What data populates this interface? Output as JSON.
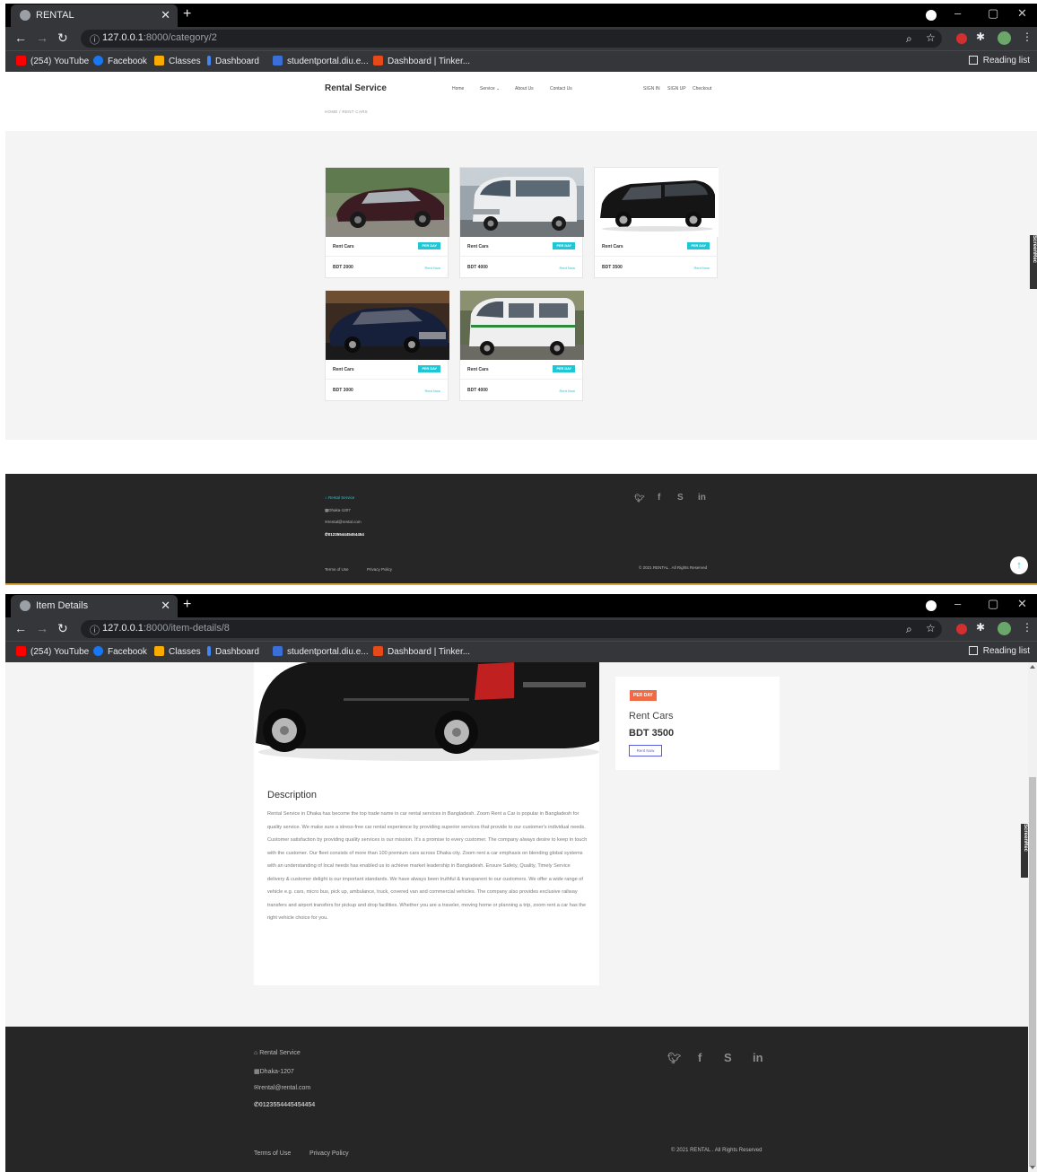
{
  "browser": {
    "bookmarks": [
      {
        "label": "(254) YouTube",
        "color": "#ff0000"
      },
      {
        "label": "Facebook",
        "color": "#1877f2"
      },
      {
        "label": "Classes",
        "color": "#f9ab00"
      },
      {
        "label": "Dashboard",
        "color": "#4285f4"
      },
      {
        "label": "studentportal.diu.e...",
        "color": "#3b6fd8"
      },
      {
        "label": "Dashboard | Tinker...",
        "color": "#e64a19"
      }
    ],
    "reading_list": "Reading list"
  },
  "window1": {
    "tab_title": "RENTAL",
    "url_host": "127.0.0.1",
    "url_rest": ":8000/category/2"
  },
  "window2": {
    "tab_title": "Item Details",
    "url_host": "127.0.0.1",
    "url_rest": ":8000/item-details/8"
  },
  "site": {
    "brand": "Rental Service",
    "nav": [
      "Home",
      "Service ⌄",
      "About Us",
      "Contact Us"
    ],
    "auth": [
      "SIGN IN",
      "SIGN UP",
      "Checkout"
    ],
    "breadcrumb": "HOME  /  RENT CARS"
  },
  "listing": {
    "cards": [
      {
        "name": "Rent Cars",
        "badge": "PER DAY",
        "price": "BDT 2000",
        "action": "Rent Now"
      },
      {
        "name": "Rent Cars",
        "badge": "PER DAY",
        "price": "BDT 4000",
        "action": "Rent Now"
      },
      {
        "name": "Rent Cars",
        "badge": "PER DAY",
        "price": "BDT 3500",
        "action": "Rent Now"
      },
      {
        "name": "Rent Cars",
        "badge": "PER DAY",
        "price": "BDT 3000",
        "action": "Rent Now"
      },
      {
        "name": "Rent Cars",
        "badge": "PER DAY",
        "price": "BDT 4000",
        "action": "Rent Now"
      }
    ]
  },
  "footer": {
    "brand": "Rental Service",
    "address": "Dhaka-1207",
    "email": "rental@rental.com",
    "phone": "0123554445454454",
    "links": [
      "Terms of Use",
      "Privacy Policy"
    ],
    "copyright": "© 2021 RENTAL . All Rights Reserved",
    "social": [
      "twitter",
      "facebook",
      "skype",
      "linkedin"
    ]
  },
  "detail": {
    "badge": "PER DAY",
    "name": "Rent Cars",
    "price": "BDT 3500",
    "action": "Rent Now",
    "description_title": "Description",
    "description": "Rental Service in Dhaka has become the top trade name in car rental services in Bangladesh. Zoom Rent a Car is popular in Bangladesh for quality service. We make sure a stress-free car rental experience by providing superior services that provide to our customer's individual needs. Customer satisfaction by providing quality services is our mission. It's a promise to every customer. The company always desire to keep in touch with the customer. Our fleet consists of more than 100 premium cars across Dhaka city. Zoom rent a car emphasis on blending global systems with an understanding of local needs has enabled us to achieve market leadership in Bangladesh. Ensure Safety, Quality, Timely Service delivery & customer delight is our important standards. We have always been truthful & transparent to our customers. We offer a wide range of vehicle e.g. cars, micro bus, pick up, ambulance, truck, covered van and commercial vehicles. The company also provides exclusive railway transfers and airport transfers for pickup and drop facilities. Whether you are a traveler, moving home or planning a trip, zoom rent a car has the right vehicle choice for you."
  },
  "extension_tab": "ScreenRec",
  "colors": {
    "accent": "#1ec6d6",
    "badge_detail": "#f06a45",
    "footer_bg": "#262626"
  }
}
